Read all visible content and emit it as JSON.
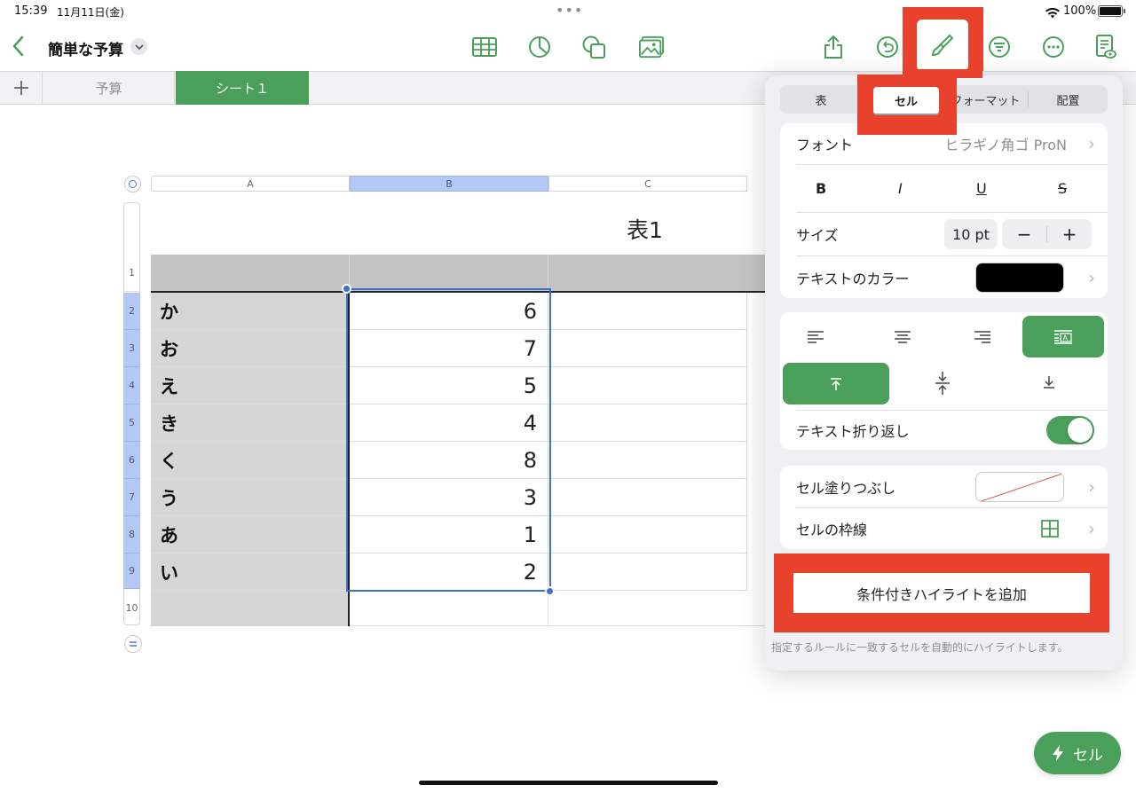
{
  "status_bar": {
    "time": "15:39",
    "date": "11月11日(金)",
    "dots": "•••",
    "battery": "100%"
  },
  "toolbar": {
    "document_title": "簡単な予算",
    "center_icons": [
      "table-icon",
      "chart-icon",
      "shape-icon",
      "media-icon"
    ],
    "right_icons": [
      "share-icon",
      "undo-icon",
      "format-brush-icon",
      "organize-icon",
      "more-icon",
      "reader-view-icon"
    ]
  },
  "sheet_tabs": {
    "add_label": "+",
    "tabs": [
      "予算",
      "シート１"
    ],
    "active": "シート１"
  },
  "spreadsheet": {
    "column_headers": [
      "A",
      "B",
      "C"
    ],
    "table_title": "表1",
    "row_numbers": [
      "1",
      "2",
      "3",
      "4",
      "5",
      "6",
      "7",
      "8",
      "9",
      "10"
    ],
    "rows": [
      {
        "a": "か",
        "b": "6"
      },
      {
        "a": "お",
        "b": "7"
      },
      {
        "a": "え",
        "b": "5"
      },
      {
        "a": "き",
        "b": "4"
      },
      {
        "a": "く",
        "b": "8"
      },
      {
        "a": "う",
        "b": "3"
      },
      {
        "a": "あ",
        "b": "1"
      },
      {
        "a": "い",
        "b": "2"
      }
    ],
    "selected_column": "B"
  },
  "format_panel": {
    "tabs": [
      "表",
      "セル",
      "フォーマット",
      "配置"
    ],
    "active_tab": "セル",
    "font_label": "フォント",
    "font_value": "ヒラギノ角ゴ ProN",
    "style_buttons": [
      "B",
      "I",
      "U",
      "S"
    ],
    "size_label": "サイズ",
    "size_value": "10 pt",
    "minus": "−",
    "plus": "+",
    "text_color_label": "テキストのカラー",
    "text_color": "#000000",
    "wrap_label": "テキスト折り返し",
    "wrap_on": true,
    "fill_label": "セル塗りつぶし",
    "border_label": "セルの枠線",
    "conditional_button": "条件付きハイライトを追加",
    "conditional_hint": "指定するルールに一致するセルを自動的にハイライトします。"
  },
  "cell_action_button": "セル",
  "colors": {
    "accent": "#4aa05a",
    "annotation": "#e8412c",
    "selection": "#3a6fd8"
  }
}
